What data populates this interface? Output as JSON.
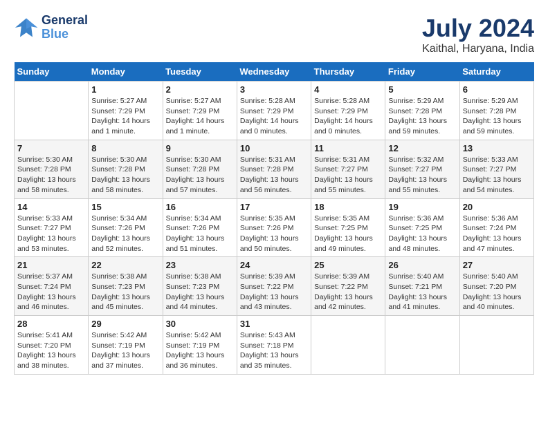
{
  "logo": {
    "line1": "General",
    "line2": "Blue"
  },
  "title": "July 2024",
  "subtitle": "Kaithal, Haryana, India",
  "header_days": [
    "Sunday",
    "Monday",
    "Tuesday",
    "Wednesday",
    "Thursday",
    "Friday",
    "Saturday"
  ],
  "weeks": [
    [
      {
        "num": "",
        "info": ""
      },
      {
        "num": "1",
        "info": "Sunrise: 5:27 AM\nSunset: 7:29 PM\nDaylight: 14 hours\nand 1 minute."
      },
      {
        "num": "2",
        "info": "Sunrise: 5:27 AM\nSunset: 7:29 PM\nDaylight: 14 hours\nand 1 minute."
      },
      {
        "num": "3",
        "info": "Sunrise: 5:28 AM\nSunset: 7:29 PM\nDaylight: 14 hours\nand 0 minutes."
      },
      {
        "num": "4",
        "info": "Sunrise: 5:28 AM\nSunset: 7:29 PM\nDaylight: 14 hours\nand 0 minutes."
      },
      {
        "num": "5",
        "info": "Sunrise: 5:29 AM\nSunset: 7:28 PM\nDaylight: 13 hours\nand 59 minutes."
      },
      {
        "num": "6",
        "info": "Sunrise: 5:29 AM\nSunset: 7:28 PM\nDaylight: 13 hours\nand 59 minutes."
      }
    ],
    [
      {
        "num": "7",
        "info": "Sunrise: 5:30 AM\nSunset: 7:28 PM\nDaylight: 13 hours\nand 58 minutes."
      },
      {
        "num": "8",
        "info": "Sunrise: 5:30 AM\nSunset: 7:28 PM\nDaylight: 13 hours\nand 58 minutes."
      },
      {
        "num": "9",
        "info": "Sunrise: 5:30 AM\nSunset: 7:28 PM\nDaylight: 13 hours\nand 57 minutes."
      },
      {
        "num": "10",
        "info": "Sunrise: 5:31 AM\nSunset: 7:28 PM\nDaylight: 13 hours\nand 56 minutes."
      },
      {
        "num": "11",
        "info": "Sunrise: 5:31 AM\nSunset: 7:27 PM\nDaylight: 13 hours\nand 55 minutes."
      },
      {
        "num": "12",
        "info": "Sunrise: 5:32 AM\nSunset: 7:27 PM\nDaylight: 13 hours\nand 55 minutes."
      },
      {
        "num": "13",
        "info": "Sunrise: 5:33 AM\nSunset: 7:27 PM\nDaylight: 13 hours\nand 54 minutes."
      }
    ],
    [
      {
        "num": "14",
        "info": "Sunrise: 5:33 AM\nSunset: 7:27 PM\nDaylight: 13 hours\nand 53 minutes."
      },
      {
        "num": "15",
        "info": "Sunrise: 5:34 AM\nSunset: 7:26 PM\nDaylight: 13 hours\nand 52 minutes."
      },
      {
        "num": "16",
        "info": "Sunrise: 5:34 AM\nSunset: 7:26 PM\nDaylight: 13 hours\nand 51 minutes."
      },
      {
        "num": "17",
        "info": "Sunrise: 5:35 AM\nSunset: 7:26 PM\nDaylight: 13 hours\nand 50 minutes."
      },
      {
        "num": "18",
        "info": "Sunrise: 5:35 AM\nSunset: 7:25 PM\nDaylight: 13 hours\nand 49 minutes."
      },
      {
        "num": "19",
        "info": "Sunrise: 5:36 AM\nSunset: 7:25 PM\nDaylight: 13 hours\nand 48 minutes."
      },
      {
        "num": "20",
        "info": "Sunrise: 5:36 AM\nSunset: 7:24 PM\nDaylight: 13 hours\nand 47 minutes."
      }
    ],
    [
      {
        "num": "21",
        "info": "Sunrise: 5:37 AM\nSunset: 7:24 PM\nDaylight: 13 hours\nand 46 minutes."
      },
      {
        "num": "22",
        "info": "Sunrise: 5:38 AM\nSunset: 7:23 PM\nDaylight: 13 hours\nand 45 minutes."
      },
      {
        "num": "23",
        "info": "Sunrise: 5:38 AM\nSunset: 7:23 PM\nDaylight: 13 hours\nand 44 minutes."
      },
      {
        "num": "24",
        "info": "Sunrise: 5:39 AM\nSunset: 7:22 PM\nDaylight: 13 hours\nand 43 minutes."
      },
      {
        "num": "25",
        "info": "Sunrise: 5:39 AM\nSunset: 7:22 PM\nDaylight: 13 hours\nand 42 minutes."
      },
      {
        "num": "26",
        "info": "Sunrise: 5:40 AM\nSunset: 7:21 PM\nDaylight: 13 hours\nand 41 minutes."
      },
      {
        "num": "27",
        "info": "Sunrise: 5:40 AM\nSunset: 7:20 PM\nDaylight: 13 hours\nand 40 minutes."
      }
    ],
    [
      {
        "num": "28",
        "info": "Sunrise: 5:41 AM\nSunset: 7:20 PM\nDaylight: 13 hours\nand 38 minutes."
      },
      {
        "num": "29",
        "info": "Sunrise: 5:42 AM\nSunset: 7:19 PM\nDaylight: 13 hours\nand 37 minutes."
      },
      {
        "num": "30",
        "info": "Sunrise: 5:42 AM\nSunset: 7:19 PM\nDaylight: 13 hours\nand 36 minutes."
      },
      {
        "num": "31",
        "info": "Sunrise: 5:43 AM\nSunset: 7:18 PM\nDaylight: 13 hours\nand 35 minutes."
      },
      {
        "num": "",
        "info": ""
      },
      {
        "num": "",
        "info": ""
      },
      {
        "num": "",
        "info": ""
      }
    ]
  ]
}
